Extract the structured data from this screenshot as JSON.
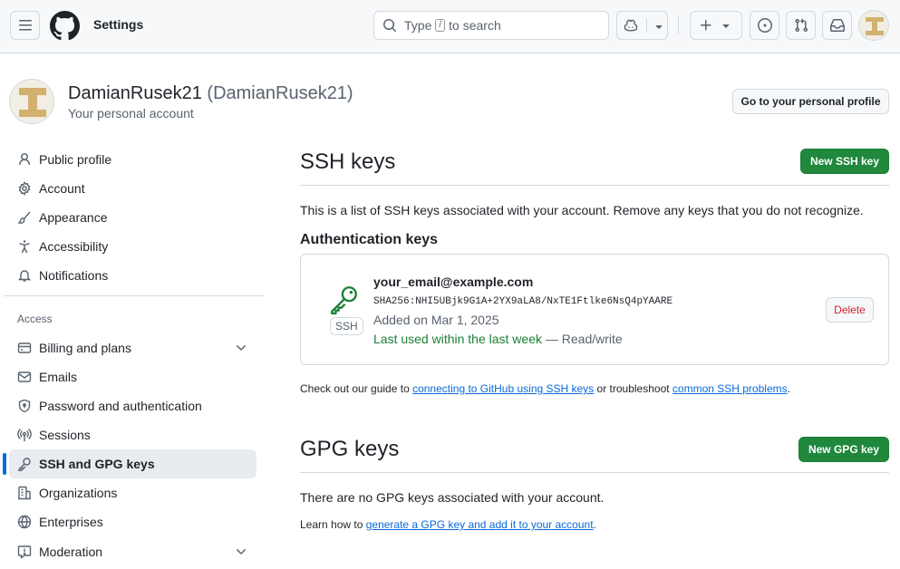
{
  "header": {
    "context_title": "Settings",
    "search_prefix": "Type",
    "search_key": "/",
    "search_suffix": "to search",
    "icons": [
      "menu-icon",
      "github-mark-icon",
      "search-icon",
      "copilot-icon",
      "triangle-down-icon",
      "plus-icon",
      "issue-opened-icon",
      "git-pull-request-icon",
      "inbox-icon"
    ]
  },
  "account": {
    "display_name": "DamianRusek21",
    "login": "(DamianRusek21)",
    "subtitle": "Your personal account",
    "profile_button": "Go to your personal profile"
  },
  "sidebar": {
    "items_top": [
      {
        "label": "Public profile",
        "icon": "person-icon"
      },
      {
        "label": "Account",
        "icon": "gear-icon"
      },
      {
        "label": "Appearance",
        "icon": "paintbrush-icon"
      },
      {
        "label": "Accessibility",
        "icon": "accessibility-icon"
      },
      {
        "label": "Notifications",
        "icon": "bell-icon"
      }
    ],
    "access_heading": "Access",
    "items_access": [
      {
        "label": "Billing and plans",
        "icon": "credit-card-icon",
        "expandable": true
      },
      {
        "label": "Emails",
        "icon": "mail-icon"
      },
      {
        "label": "Password and authentication",
        "icon": "shield-lock-icon"
      },
      {
        "label": "Sessions",
        "icon": "broadcast-icon"
      },
      {
        "label": "SSH and GPG keys",
        "icon": "key-icon",
        "active": true
      },
      {
        "label": "Organizations",
        "icon": "organization-icon"
      },
      {
        "label": "Enterprises",
        "icon": "globe-icon"
      },
      {
        "label": "Moderation",
        "icon": "report-icon",
        "expandable": true
      }
    ]
  },
  "ssh": {
    "title": "SSH keys",
    "new_button": "New SSH key",
    "description": "This is a list of SSH keys associated with your account. Remove any keys that you do not recognize.",
    "auth_heading": "Authentication keys",
    "keys": [
      {
        "title": "your_email@example.com",
        "fingerprint": "SHA256:NHI5UBjk9G1A+2YX9aLA8/NxTE1Ftlke6NsQ4pYAARE",
        "type_label": "SSH",
        "added": "Added on Mar 1, 2025",
        "last_used": "Last used within the last week",
        "access": " — Read/write",
        "delete_label": "Delete"
      }
    ],
    "guide_prefix": "Check out our guide to ",
    "guide_link1": "connecting to GitHub using SSH keys",
    "guide_mid": " or troubleshoot ",
    "guide_link2": "common SSH problems",
    "guide_suffix": "."
  },
  "gpg": {
    "title": "GPG keys",
    "new_button": "New GPG key",
    "empty_text": "There are no GPG keys associated with your account.",
    "learn_prefix": "Learn how to ",
    "learn_link": "generate a GPG key and add it to your account",
    "learn_suffix": "."
  },
  "colors": {
    "accent": "#0969da",
    "primary_button": "#1f883d",
    "success_text": "#1a7f37",
    "danger_text": "#d1242f",
    "avatar_identicon": "#d2b16e"
  }
}
